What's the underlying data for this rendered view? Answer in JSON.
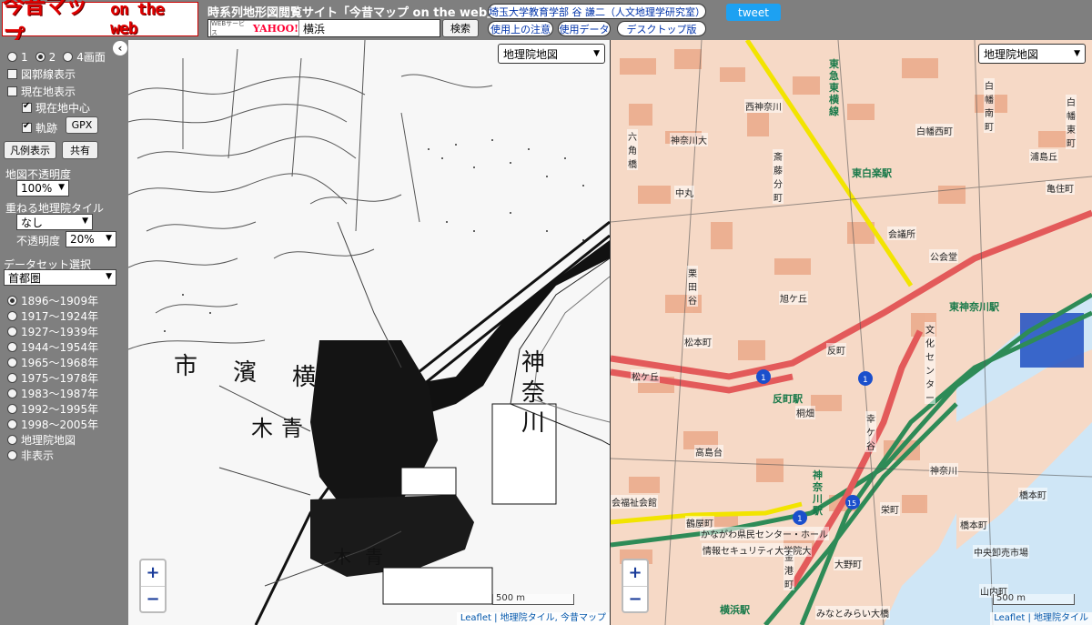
{
  "header": {
    "logo_main": "今昔マップ",
    "logo_sub": "on the web",
    "site_title": "時系列地形図閲覧サイト「今昔マップ on the web」",
    "web_service_label": "WEBサービス",
    "yahoo_label": "YAHOO!",
    "search_value": "横浜",
    "search_button": "検索",
    "author_link": "埼玉大学教育学部 谷 謙二（人文地理学研究室）",
    "notice_link": "使用上の注意",
    "data_link": "使用データ",
    "desktop_link": "デスクトップ版",
    "tweet_label": "tweet"
  },
  "sidebar": {
    "collapse_glyph": "‹",
    "view_options": [
      {
        "label": "1",
        "selected": false
      },
      {
        "label": "2",
        "selected": true
      },
      {
        "label": "4画面",
        "selected": false
      }
    ],
    "checkboxes": [
      {
        "label": "図郭線表示",
        "checked": false
      },
      {
        "label": "現在地表示",
        "checked": false
      },
      {
        "label": "現在地中心",
        "checked": true
      },
      {
        "label": "軌跡",
        "checked": true
      }
    ],
    "gpx_button": "GPX",
    "legend_button": "凡例表示",
    "share_button": "共有",
    "opacity_label": "地図不透明度",
    "opacity_value": "100%",
    "overlay_label": "重ねる地理院タイル",
    "overlay_value": "なし",
    "overlay_opacity_label": "不透明度",
    "overlay_opacity_value": "20%",
    "dataset_label": "データセット選択",
    "dataset_value": "首都圏",
    "periods": [
      {
        "label": "1896～1909年",
        "selected": true
      },
      {
        "label": "1917～1924年",
        "selected": false
      },
      {
        "label": "1927～1939年",
        "selected": false
      },
      {
        "label": "1944～1954年",
        "selected": false
      },
      {
        "label": "1965～1968年",
        "selected": false
      },
      {
        "label": "1975～1978年",
        "selected": false
      },
      {
        "label": "1983～1987年",
        "selected": false
      },
      {
        "label": "1992～1995年",
        "selected": false
      },
      {
        "label": "1998～2005年",
        "selected": false
      },
      {
        "label": "地理院地図",
        "selected": false
      },
      {
        "label": "非表示",
        "selected": false
      }
    ]
  },
  "map_left": {
    "layer_select": "地理院地図",
    "labels": [
      "市",
      "濱",
      "横",
      "神",
      "奈",
      "川",
      "木",
      "青"
    ],
    "scale_label": "500 m",
    "attribution": "Leaflet | 地理院タイル, 今昔マップ",
    "zoom_in": "+",
    "zoom_out": "−"
  },
  "map_right": {
    "layer_select": "地理院地図",
    "place_labels": [
      "西神奈川",
      "神奈川大",
      "六角橋",
      "斎藤分町",
      "白幡西町",
      "白幡東町",
      "白幡南町",
      "浦島丘",
      "亀住町",
      "中丸",
      "栗田谷",
      "旭ケ丘",
      "松本町",
      "松ケ丘",
      "反町",
      "反町駅",
      "桐畑",
      "幸ケ谷",
      "高島台",
      "神奈川",
      "橋本町",
      "栄町",
      "会議所",
      "公会堂",
      "文化センター",
      "東白楽駅",
      "東神奈川駅",
      "神奈川駅",
      "横浜駅",
      "金港町",
      "大野町",
      "中央卸売市場",
      "山内町",
      "鶴屋町",
      "かながわ県民センター・ホール",
      "情報セキュリティ大学院大",
      "みなとみらい大橋",
      "会福祉会館"
    ],
    "green_labels": [
      "東急東横線",
      "東白楽駅",
      "東神奈川駅",
      "反町駅",
      "神奈川駅",
      "横浜駅"
    ],
    "scale_label": "500 m",
    "attribution": "Leaflet | 地理院タイル",
    "zoom_in": "+",
    "zoom_out": "−"
  },
  "colors": {
    "panel_bg": "#7f7f7f",
    "logo_red": "#e00000",
    "tweet_blue": "#1da1f2",
    "rail_green": "#2e8b57",
    "road_red": "#e35a5a",
    "road_yellow": "#f2e400"
  }
}
